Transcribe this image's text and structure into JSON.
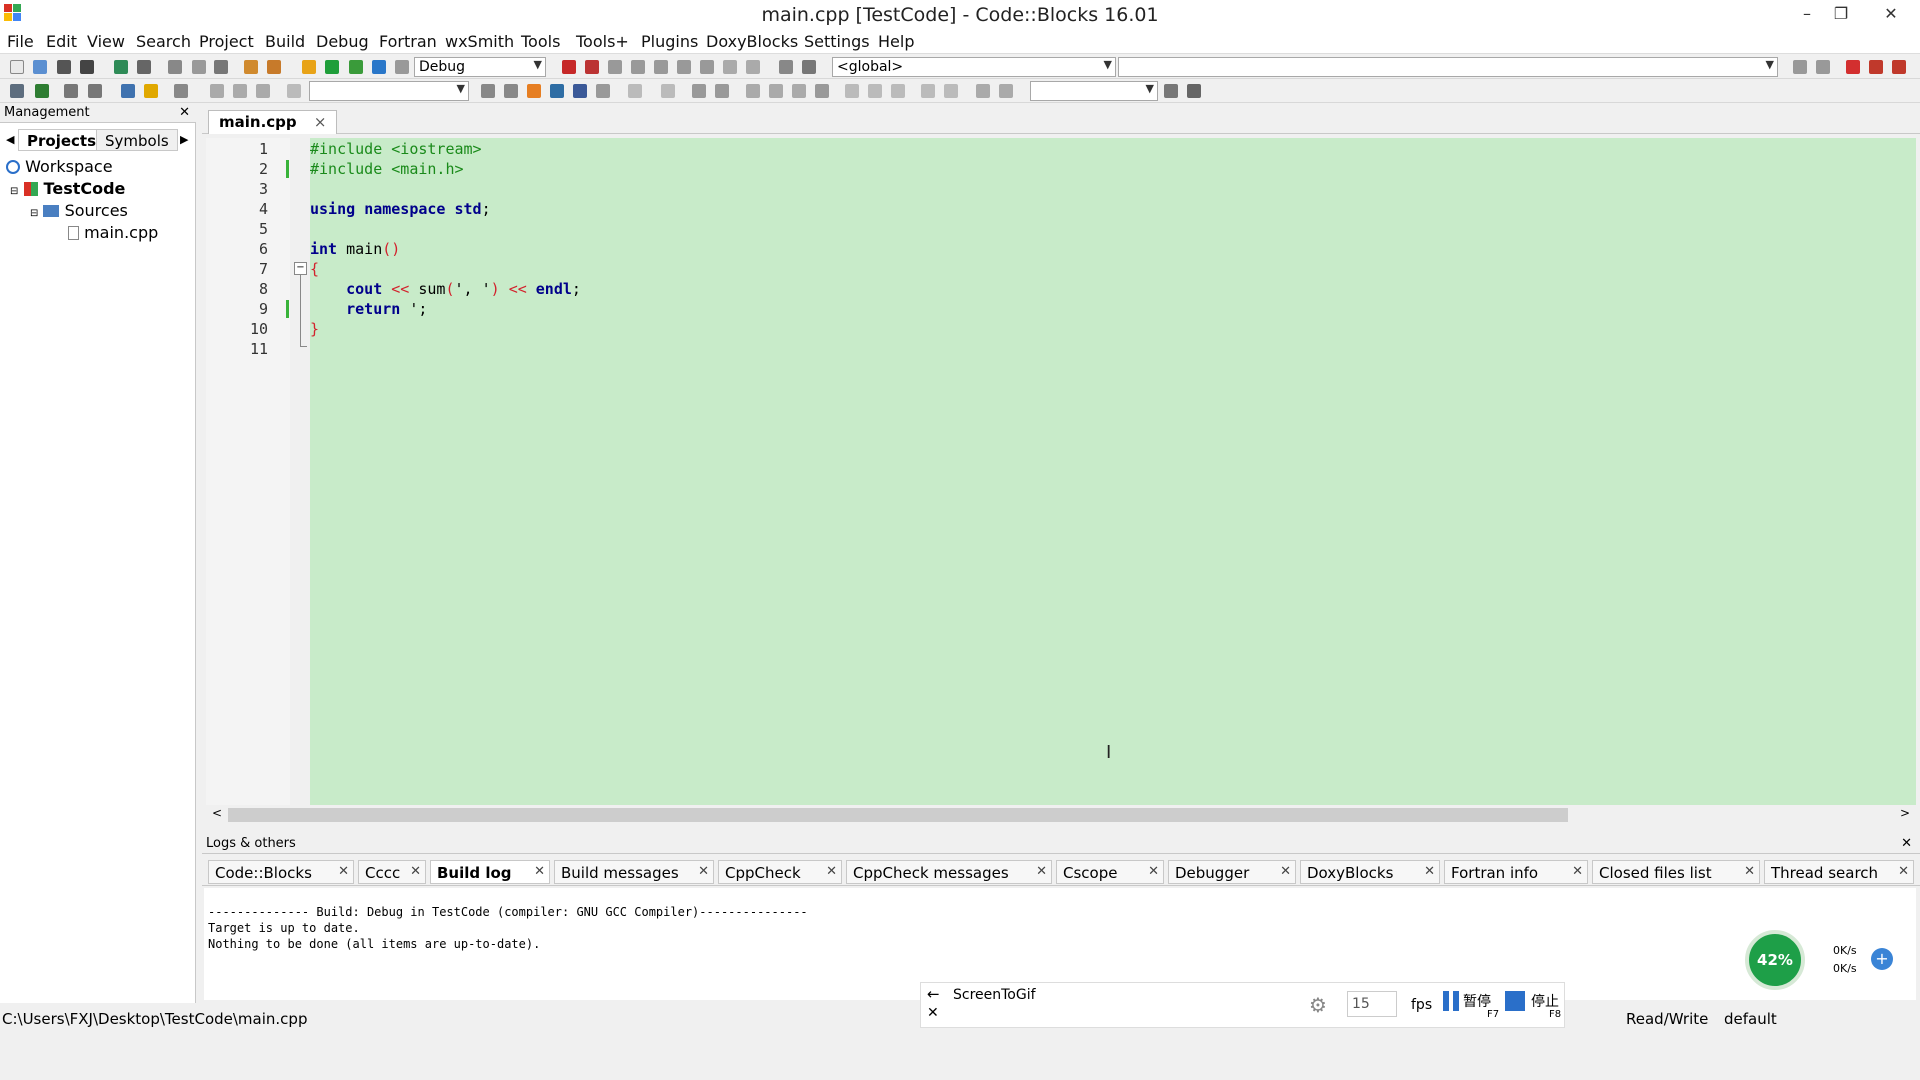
{
  "window": {
    "title": "main.cpp [TestCode] - Code::Blocks 16.01",
    "minimize": "–",
    "maximize": "❐",
    "close": "✕"
  },
  "menu": [
    "File",
    "Edit",
    "View",
    "Search",
    "Project",
    "Build",
    "Debug",
    "Fortran",
    "wxSmith",
    "Tools",
    "Tools+",
    "Plugins",
    "DoxyBlocks",
    "Settings",
    "Help"
  ],
  "toolbar": {
    "build_target": "Debug",
    "scope": "<global>"
  },
  "management": {
    "title": "Management",
    "close": "✕",
    "tabs": [
      "Projects",
      "Symbols"
    ],
    "tree": {
      "workspace": "Workspace",
      "project": "TestCode",
      "folder": "Sources",
      "file": "main.cpp"
    }
  },
  "editor": {
    "tab": "main.cpp",
    "tab_close": "×",
    "line_numbers": [
      "1",
      "2",
      "3",
      "4",
      "5",
      "6",
      "7",
      "8",
      "9",
      "10",
      "11"
    ]
  },
  "logs": {
    "title": "Logs & others",
    "close": "✕",
    "tabs": [
      "Code::Blocks",
      "Cccc",
      "Build log",
      "Build messages",
      "CppCheck",
      "CppCheck messages",
      "Cscope",
      "Debugger",
      "DoxyBlocks",
      "Fortran info",
      "Closed files list",
      "Thread search"
    ],
    "lines": [
      "-------------- Build: Debug in TestCode (compiler: GNU GCC Compiler)---------------",
      "",
      "Target is up to date.",
      "Nothing to be done (all items are up-to-date)."
    ]
  },
  "status": {
    "path": "C:\\Users\\FXJ\\Desktop\\TestCode\\main.cpp",
    "rw": "Read/Write",
    "profile": "default"
  },
  "screentogif": {
    "title": "ScreenToGif",
    "fps_value": "15",
    "fps_label": "fps",
    "pause": "暂停",
    "pause_key": "F7",
    "stop": "停止",
    "stop_key": "F8"
  },
  "netmon": {
    "percent": "42%",
    "up": "0K/s",
    "down": "0K/s"
  }
}
